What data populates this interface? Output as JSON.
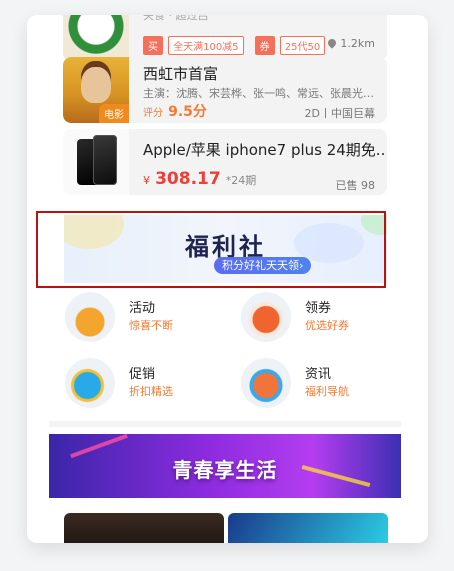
{
  "listings": [
    {
      "title": "",
      "sub_text": "关食 · 超过吕",
      "tags": [
        "买",
        "全天满100减5",
        "券",
        "25代50"
      ],
      "distance": "1.2km",
      "location_icon": "location-pin-icon"
    },
    {
      "title": "西虹市首富",
      "cast": "主演：沈腾、宋芸桦、张一鸣、常远、张晨光、...",
      "rating_label": "评分",
      "rating_value": "9.5分",
      "format": "2D丨中国巨幕",
      "badge": "电影"
    },
    {
      "title": "Apple/苹果 iphone7 plus 24期免...",
      "price_symbol": "¥",
      "price": "308.17",
      "installments": "*24期",
      "sold": "已售 98"
    }
  ],
  "welfare": {
    "title": "福利社",
    "pill": "积分好礼天天领›"
  },
  "features": [
    {
      "name": "活动",
      "desc": "惊喜不断",
      "icon": "gift-box-icon"
    },
    {
      "name": "领券",
      "desc": "优选好券",
      "icon": "coupon-ticket-icon"
    },
    {
      "name": "促销",
      "desc": "折扣精选",
      "icon": "shopping-bag-icon"
    },
    {
      "name": "资讯",
      "desc": "福利导航",
      "icon": "news-letter-icon"
    }
  ],
  "promo": {
    "text": "青春享生活"
  },
  "colors": {
    "accent_orange": "#f47a32",
    "price_red": "#ef3e3a",
    "highlight_border": "#b7130f"
  }
}
